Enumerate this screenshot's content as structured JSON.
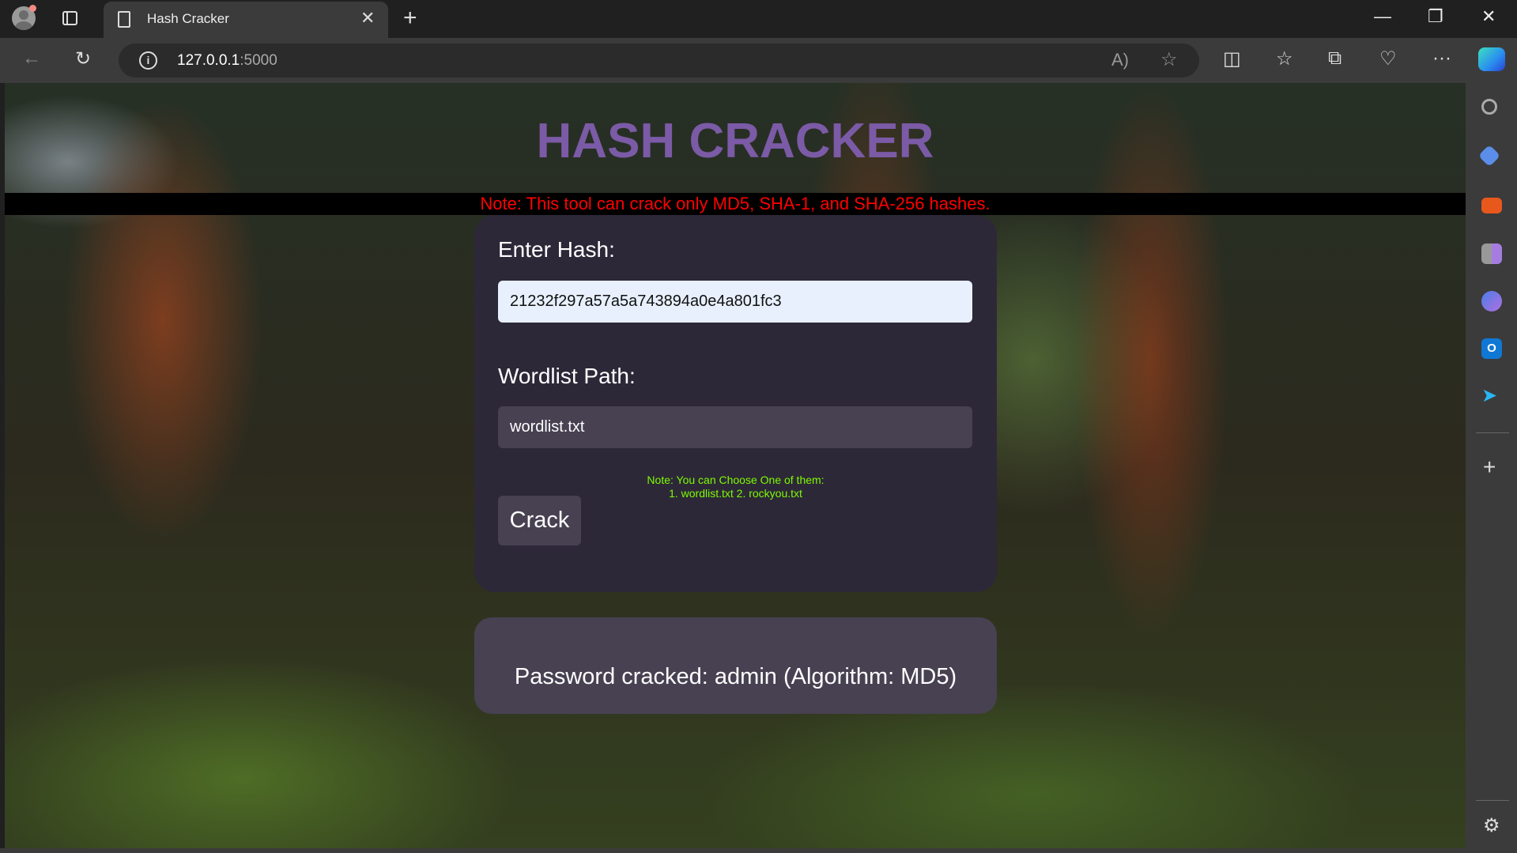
{
  "browser": {
    "tab_title": "Hash Cracker",
    "url_host": "127.0.0.1",
    "url_port": ":5000"
  },
  "page": {
    "title": "HASH CRACKER",
    "note": "Note: This tool can crack only MD5, SHA-1, and SHA-256 hashes.",
    "hash_label": "Enter Hash:",
    "hash_value": "21232f297a57a5a743894a0e4a801fc3",
    "wordlist_label": "Wordlist Path:",
    "wordlist_value": "wordlist.txt",
    "wordlist_note_line1": "Note: You can Choose One of them:",
    "wordlist_note_line2": "1. wordlist.txt 2. rockyou.txt",
    "crack_label": "Crack",
    "result": "Password cracked: admin (Algorithm: MD5)"
  },
  "colors": {
    "title": "#7b5aa6",
    "note": "#ff0000",
    "green_note": "#7cfc00",
    "card": "#2d2838"
  }
}
